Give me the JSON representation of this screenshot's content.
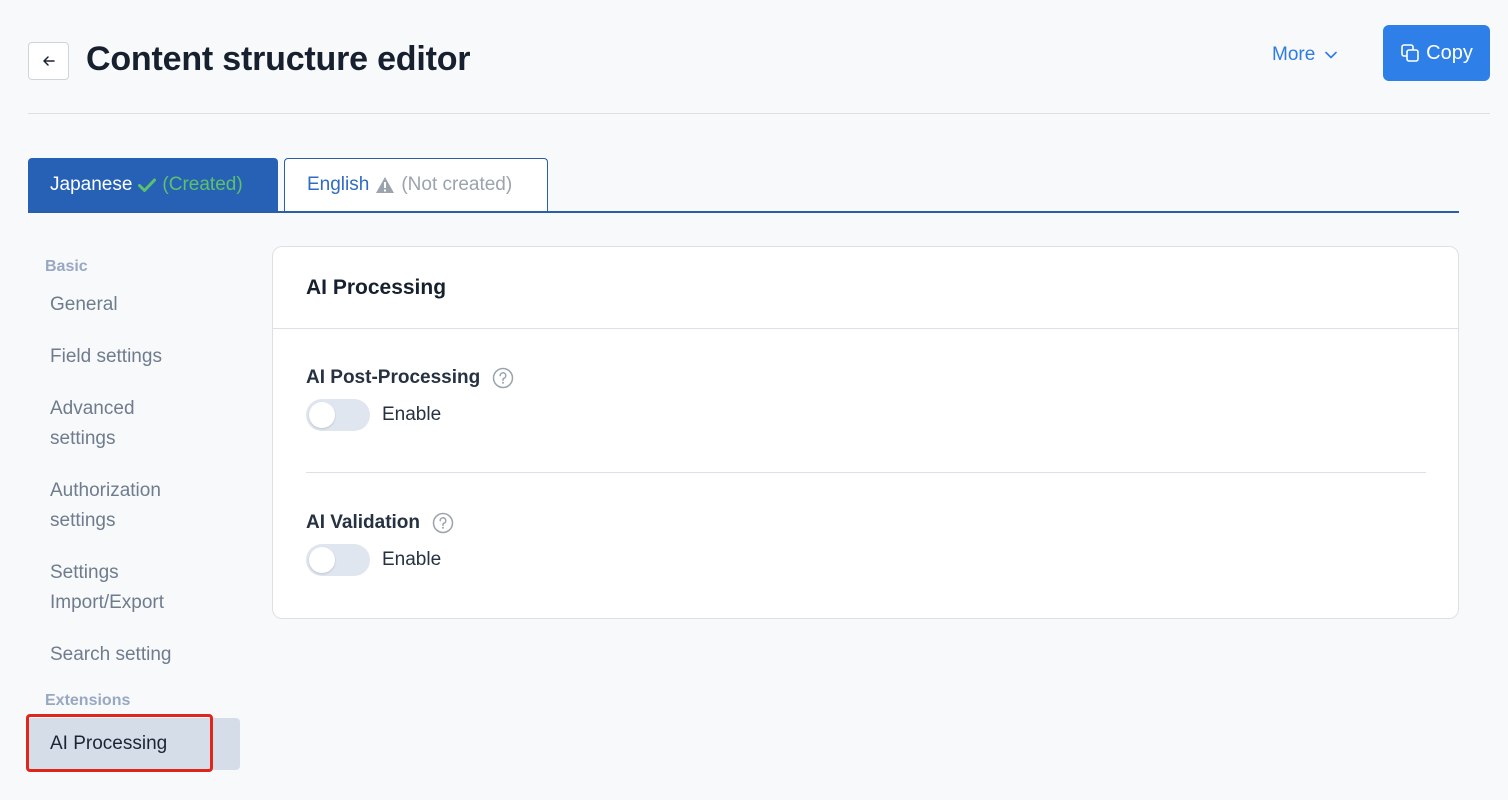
{
  "header": {
    "title": "Content structure editor",
    "more_label": "More",
    "copy_label": "Copy"
  },
  "tabs": [
    {
      "label": "Japanese",
      "status": "(Created)",
      "active": true
    },
    {
      "label": "English",
      "status": "(Not created)",
      "active": false
    }
  ],
  "sidebar": {
    "sections": [
      {
        "title": "Basic",
        "items": [
          {
            "label": "General"
          },
          {
            "label": "Field settings"
          },
          {
            "label": "Advanced settings"
          },
          {
            "label": "Authorization settings"
          },
          {
            "label": "Settings Import/Export"
          },
          {
            "label": "Search setting"
          }
        ]
      },
      {
        "title": "Extensions",
        "items": [
          {
            "label": "AI Processing",
            "active": true
          }
        ]
      }
    ]
  },
  "card": {
    "title": "AI Processing",
    "settings": [
      {
        "label": "AI Post-Processing",
        "toggle_label": "Enable",
        "enabled": false
      },
      {
        "label": "AI Validation",
        "toggle_label": "Enable",
        "enabled": false
      }
    ]
  },
  "colors": {
    "primary": "#2e80e8",
    "tab_active": "#2761b6",
    "created": "#5cc16b",
    "highlight": "#e0261c"
  }
}
